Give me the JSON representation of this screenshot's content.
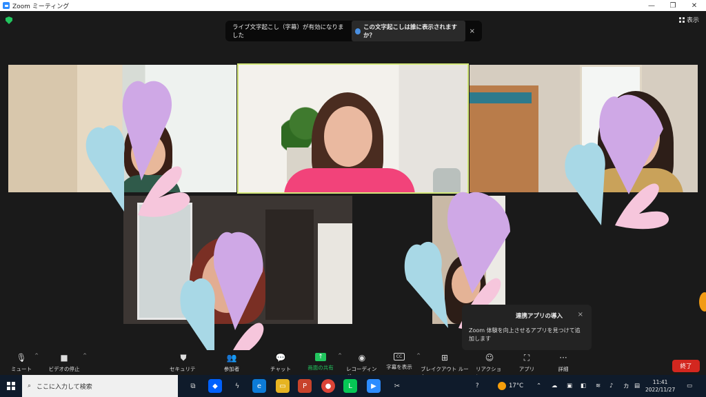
{
  "window": {
    "title": "Zoom ミーティング",
    "minimize": "—",
    "maximize": "❐",
    "close": "✕"
  },
  "header": {
    "view_label": "表示"
  },
  "banner": {
    "message": "ライブ文字起こし（字幕）が有効になりました",
    "action": "この文字起こしは誰に表示されますか？",
    "close": "×"
  },
  "popup": {
    "title": "連携アプリの導入",
    "body": "Zoom 体験を向上させるアプリを見つけて追加します",
    "close": "×"
  },
  "toolbar": {
    "mute": "ミュート",
    "video": "ビデオの停止",
    "security": "セキュリティ",
    "participants": "参加者",
    "chat": "チャット",
    "share": "画面の共有",
    "record": "レコーディング",
    "captions": "字幕を表示",
    "cc": "CC",
    "breakout": "ブレイクアウト ルーム",
    "reactions": "リアクション",
    "apps": "アプリ",
    "more": "詳細",
    "end": "終了",
    "caret": "^"
  },
  "taskbar": {
    "search_placeholder": "ここに入力して検索",
    "weather": "17°C",
    "ime": "カ",
    "time": "11:41",
    "date": "2022/11/27"
  },
  "colors": {
    "accent": "#2d8cff",
    "share_green": "#22c55e",
    "end_red": "#d3271f",
    "active_speaker_border": "#d4e87a",
    "heart_purple": "#cfa8e6",
    "heart_blue": "#a8d8e6",
    "heart_pink": "#f6c6dc"
  }
}
